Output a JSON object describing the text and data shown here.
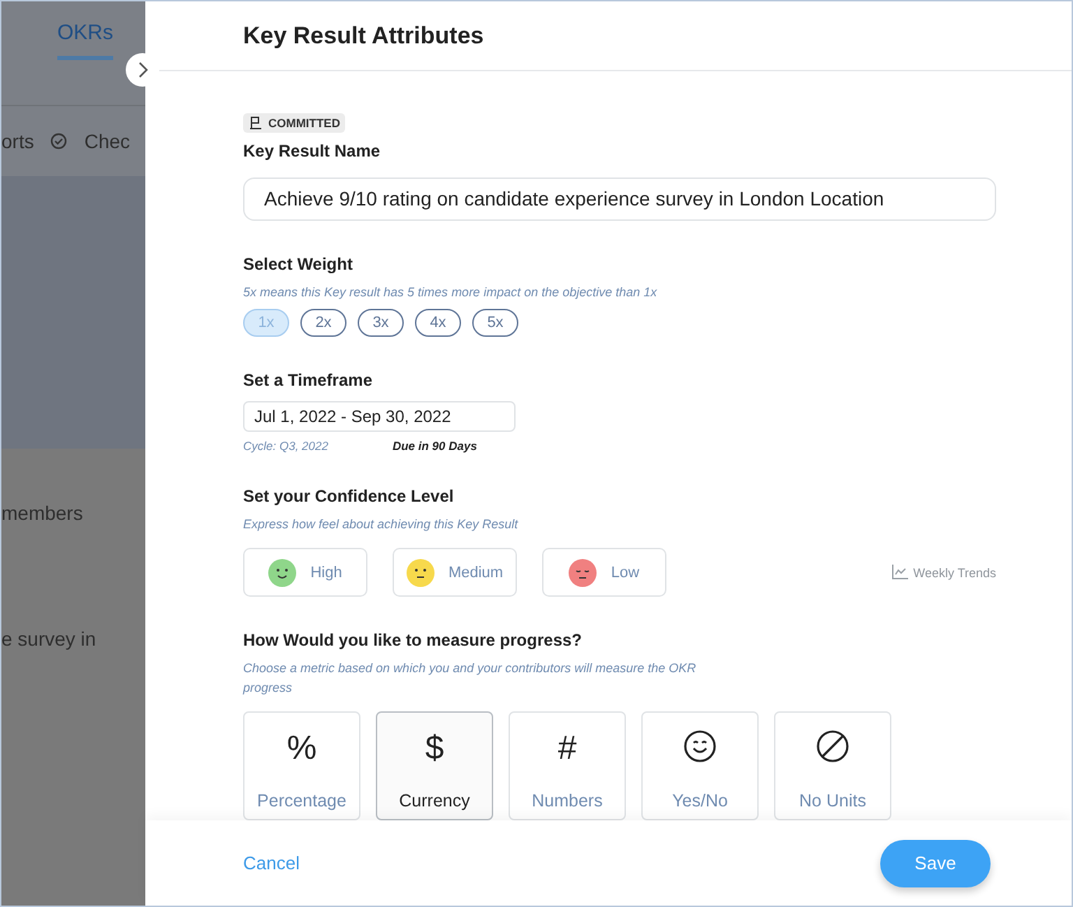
{
  "background": {
    "tab": "OKRs",
    "menu": "orts",
    "check": "Chec",
    "row_1": "members",
    "row_2": "e survey in"
  },
  "panel": {
    "title": "Key Result Attributes",
    "badge": "COMMITTED",
    "name_label": "Key Result Name",
    "name_value": "Achieve 9/10 rating on candidate experience survey in London Location",
    "weight": {
      "label": "Select Weight",
      "hint": "5x means this Key result has 5 times more impact on the objective than 1x",
      "options": [
        {
          "label": "1x",
          "selected": true
        },
        {
          "label": "2x",
          "selected": false
        },
        {
          "label": "3x",
          "selected": false
        },
        {
          "label": "4x",
          "selected": false
        },
        {
          "label": "5x",
          "selected": false
        }
      ]
    },
    "timeframe": {
      "label": "Set a Timeframe",
      "value": "Jul 1, 2022 - Sep 30, 2022",
      "cycle": "Cycle: Q3, 2022",
      "due": "Due in 90 Days"
    },
    "confidence": {
      "label": "Set your Confidence Level",
      "hint": "Express how feel about achieving this Key Result",
      "options": [
        {
          "label": "High",
          "kind": "happy",
          "color": "#8fd68a"
        },
        {
          "label": "Medium",
          "kind": "neutral",
          "color": "#f7d94c"
        },
        {
          "label": "Low",
          "kind": "sad",
          "color": "#f08080"
        }
      ],
      "trends": "Weekly Trends"
    },
    "measure": {
      "label": "How Would you like to measure progress?",
      "hint": "Choose a metric based on which you and your contributors will measure the OKR progress",
      "options": [
        {
          "label": "Percentage",
          "symbol": "%",
          "kind": "text",
          "selected": false
        },
        {
          "label": "Currency",
          "symbol": "$",
          "kind": "text",
          "selected": true
        },
        {
          "label": "Numbers",
          "symbol": "#",
          "kind": "text",
          "selected": false
        },
        {
          "label": "Yes/No",
          "kind": "smile",
          "selected": false
        },
        {
          "label": "No Units",
          "kind": "none",
          "selected": false
        }
      ]
    },
    "cancel": "Cancel",
    "save": "Save"
  }
}
